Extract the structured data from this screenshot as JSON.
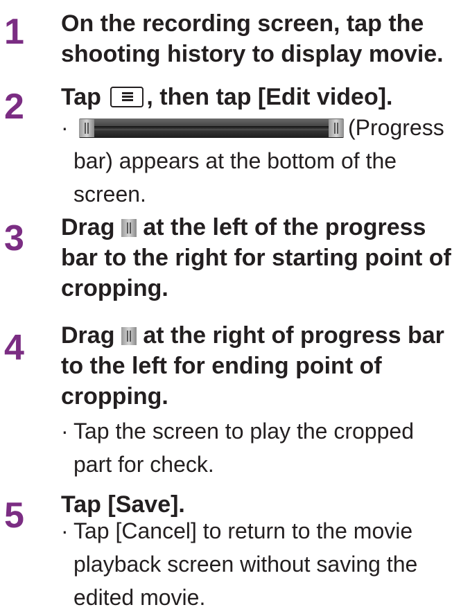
{
  "steps": [
    {
      "number": "1",
      "heading": "On the recording screen, tap the shooting history to display movie."
    },
    {
      "number": "2",
      "heading_before": "Tap ",
      "heading_after": ", then tap [Edit video].",
      "icon": "menu-icon",
      "bullet_icon": "progress-bar-icon",
      "bullet_text_1": "(Progress",
      "bullet_text_2": "bar) appears at the bottom of the",
      "bullet_text_3": "screen."
    },
    {
      "number": "3",
      "heading_before": "Drag ",
      "heading_after": " at the left of the progress",
      "heading_line2": "bar to the right for starting point of",
      "heading_line3": "cropping.",
      "icon": "handle-icon"
    },
    {
      "number": "4",
      "heading_before": "Drag ",
      "heading_after": " at the right of progress bar",
      "heading_line2": "to the left for ending point of",
      "heading_line3": "cropping.",
      "icon": "handle-icon",
      "bullet_line1": "Tap the screen to play the cropped",
      "bullet_line2": "part for check."
    },
    {
      "number": "5",
      "heading": "Tap [Save].",
      "bullet_line1": "Tap [Cancel] to return to the movie",
      "bullet_line2": "playback screen without saving the",
      "bullet_line3": "edited movie."
    }
  ],
  "colors": {
    "number": "#7b2d83",
    "text": "#231f20"
  }
}
